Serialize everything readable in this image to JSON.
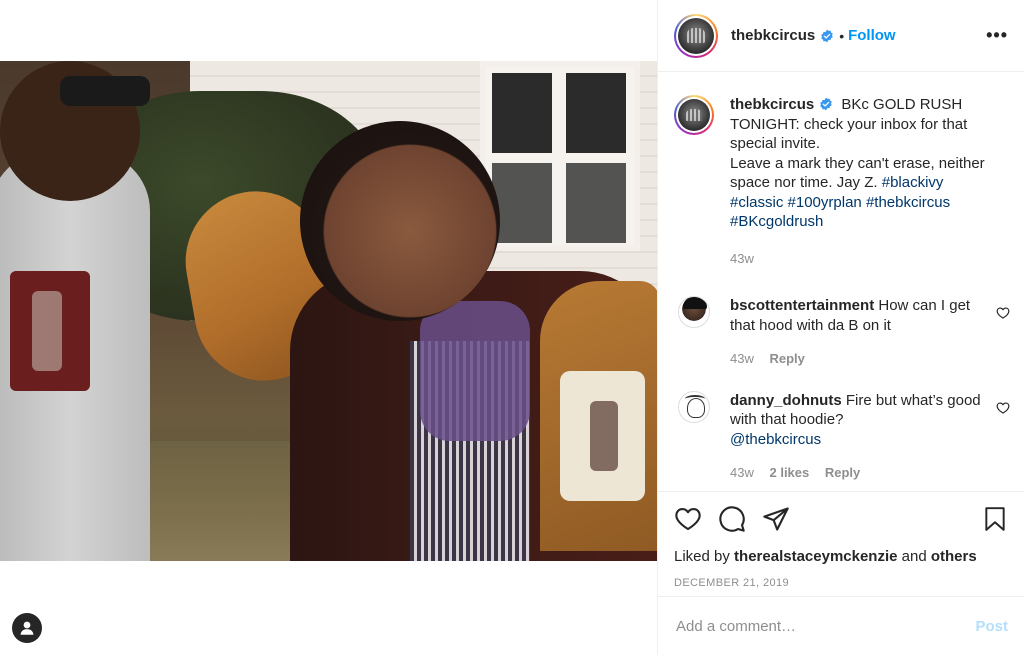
{
  "post": {
    "username": "thebkcircus",
    "follow_label": "Follow",
    "dot": "•",
    "more_label": "•••"
  },
  "caption": {
    "username": "thebkcircus",
    "line1": "BKc GOLD RUSH TONIGHT: check your inbox for that special invite.",
    "line2": "Leave a mark they can't erase, neither space nor time. Jay Z. ",
    "hashtags": [
      "#blackivy",
      "#classic",
      "#100yrplan",
      "#thebkcircus",
      "#BKcgoldrush"
    ],
    "time": "43w"
  },
  "comments": [
    {
      "username": "bscottentertainment",
      "text": "How can I get that hood with da B on it",
      "time": "43w",
      "reply_label": "Reply"
    },
    {
      "username": "danny_dohnuts",
      "text": "Fire but what’s good with that hoodie? ",
      "mention": "@thebkcircus",
      "time": "43w",
      "likes": "2 likes",
      "reply_label": "Reply"
    }
  ],
  "likes": {
    "prefix": "Liked by",
    "user": "therealstaceymckenzie",
    "and": "and",
    "others": "others"
  },
  "date": "DECEMBER 21, 2019",
  "add_comment": {
    "placeholder": "Add a comment…",
    "post_label": "Post"
  },
  "colors": {
    "accent": "#0095f6",
    "link": "#00376b",
    "muted": "#8e8e8e",
    "post_disabled": "#b2dffc"
  }
}
